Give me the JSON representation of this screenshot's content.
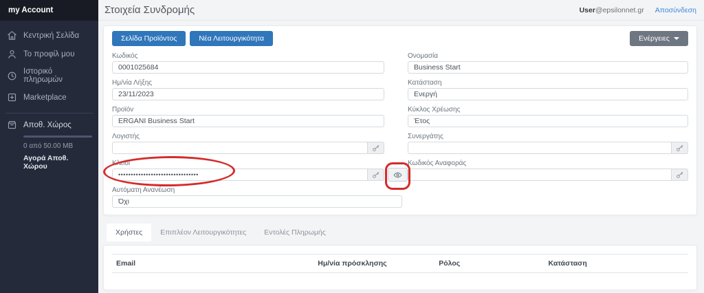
{
  "sidebar": {
    "brand": "my Account",
    "items": [
      {
        "label": "Κεντρική Σελίδα",
        "icon": "home-icon"
      },
      {
        "label": "Το προφίλ μου",
        "icon": "user-icon"
      },
      {
        "label": "Ιστορικό πληρωμών",
        "icon": "history-icon"
      },
      {
        "label": "Marketplace",
        "icon": "marketplace-icon"
      }
    ],
    "storage": {
      "label": "Αποθ. Χώρος",
      "usage": "0 από 50.00 MB",
      "buy_link": "Αγορά Αποθ. Χώρου"
    }
  },
  "header": {
    "title": "Στοιχεία Συνδρομής",
    "user_name": "User",
    "user_domain": "@epsilonnet.gr",
    "logout_label": "Αποσύνδεση"
  },
  "toolbar": {
    "product_page_label": "Σελίδα Προϊόντος",
    "new_feature_label": "Νέα Λειτουργικότητα",
    "actions_label": "Ενέργειες"
  },
  "form": {
    "code": {
      "label": "Κωδικός",
      "value": "0001025684"
    },
    "name": {
      "label": "Ονομασία",
      "value": "Business Start"
    },
    "expiry": {
      "label": "Ημ/νία Λήξης",
      "value": "23/11/2023"
    },
    "status": {
      "label": "Κατάσταση",
      "value": "Ενεργή"
    },
    "product": {
      "label": "Προϊόν",
      "value": "ERGANI Business Start"
    },
    "billing_cycle": {
      "label": "Κύκλος Χρέωσης",
      "value": "Έτος"
    },
    "accountant": {
      "label": "Λογιστής",
      "value": ""
    },
    "partner": {
      "label": "Συνεργάτης",
      "value": ""
    },
    "key": {
      "label": "Κλειδί",
      "value": "••••••••••••••••••••••••••••••••"
    },
    "reference_code": {
      "label": "Κωδικός Αναφοράς",
      "value": ""
    },
    "auto_renew": {
      "label": "Αυτόματη Ανανέωση",
      "value": "Όχι"
    }
  },
  "tabs": [
    {
      "label": "Χρήστες"
    },
    {
      "label": "Επιπλέον Λειτουργικότητες"
    },
    {
      "label": "Εντολές Πληρωμής"
    }
  ],
  "users_table": {
    "columns": [
      "Email",
      "Ημ/νία πρόσκλησης",
      "Ρόλος",
      "Κατάσταση"
    ],
    "rows": []
  },
  "colors": {
    "sidebar_bg": "#252a3a",
    "sidebar_brand_bg": "#181b23",
    "primary_button": "#3076bb",
    "actions_button": "#6e7681",
    "link_blue": "#3c86d8",
    "annotation_red": "#d52b2b"
  }
}
